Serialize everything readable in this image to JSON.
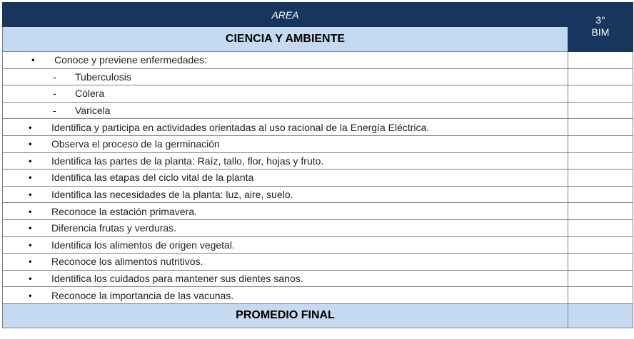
{
  "header": {
    "area_label": "AREA",
    "subject": "CIENCIA Y AMBIENTE",
    "bim_label_line1": "3°",
    "bim_label_line2": "BIM"
  },
  "items": [
    {
      "kind": "first",
      "marker": "•",
      "text": "Conoce y previene enfermedades:"
    },
    {
      "kind": "sub",
      "marker": "-",
      "text": "Tuberculosis"
    },
    {
      "kind": "sub",
      "marker": "-",
      "text": "Cólera"
    },
    {
      "kind": "sub",
      "marker": "-",
      "text": "Varicela"
    },
    {
      "kind": "main",
      "marker": "•",
      "text": "Identifica y participa en actividades orientadas al uso racional de la Energía Eléctrica."
    },
    {
      "kind": "main",
      "marker": "•",
      "text": "Observa el proceso de la germinación"
    },
    {
      "kind": "main",
      "marker": "•",
      "text": "Identifica las partes de la planta: Raíz, tallo, flor, hojas y fruto."
    },
    {
      "kind": "main",
      "marker": "•",
      "text": "Identifica las etapas del ciclo vital de la planta"
    },
    {
      "kind": "main",
      "marker": "•",
      "text": "Identifica las necesidades de la planta: luz, aire, suelo."
    },
    {
      "kind": "main",
      "marker": "•",
      "text": "Reconoce la estación primavera."
    },
    {
      "kind": "main",
      "marker": "•",
      "text": "Diferencia frutas y verduras."
    },
    {
      "kind": "main",
      "marker": "•",
      "text": "Identifica los alimentos de origen vegetal."
    },
    {
      "kind": "main",
      "marker": "•",
      "text": "Reconoce los alimentos nutritivos."
    },
    {
      "kind": "main",
      "marker": "•",
      "text": "Identifica los cuidados para mantener sus dientes sanos."
    },
    {
      "kind": "main",
      "marker": "•",
      "text": "Reconoce la importancia de las vacunas."
    }
  ],
  "footer": {
    "final_label": "PROMEDIO FINAL"
  },
  "colors": {
    "header_navy": "#17365d",
    "subject_blue": "#c5d9f1",
    "grid_gray": "#7f7f7f"
  }
}
